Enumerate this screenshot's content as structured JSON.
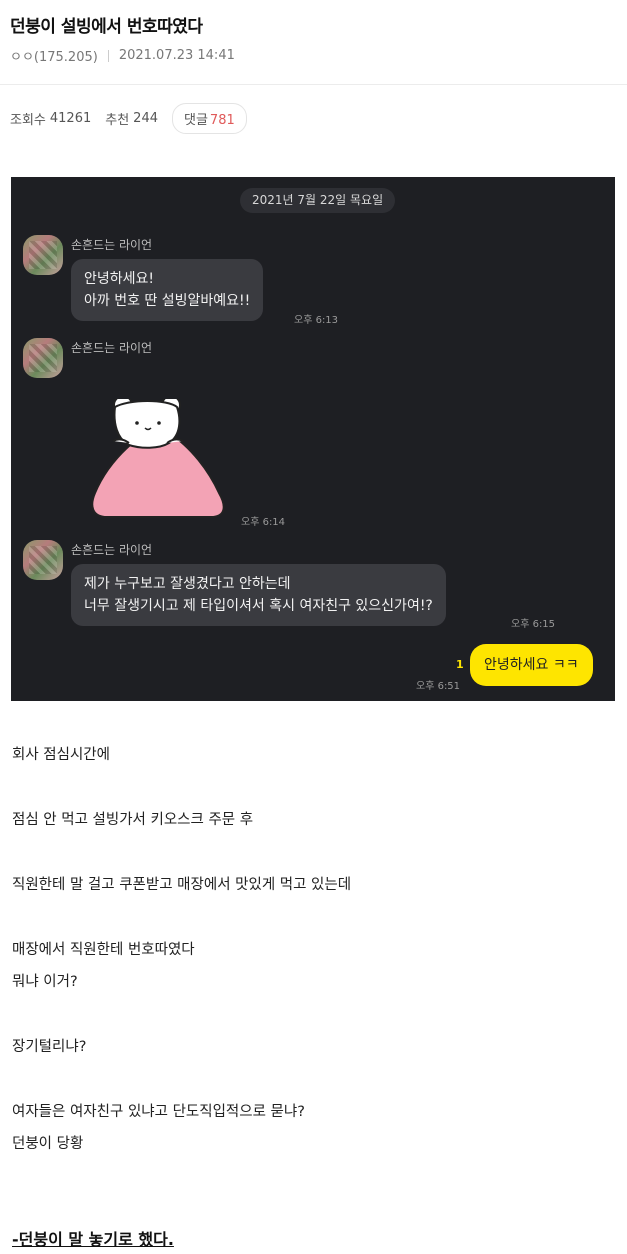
{
  "post": {
    "title": "던붕이 설빙에서 번호따였다",
    "author": "ㅇㅇ(175.205)",
    "datetime": "2021.07.23 14:41"
  },
  "stats": {
    "views_label": "조회수",
    "views": "41261",
    "recommend_label": "추천",
    "recommend": "244",
    "comments_label": "댓글",
    "comments": "781"
  },
  "chat": {
    "date": "2021년 7월 22일 목요일",
    "messages": [
      {
        "sender": "손흔드는 라이언",
        "text": "안녕하세요!\n아까 번호 딴 설빙알바예요!!",
        "time": "오후 6:13"
      },
      {
        "sender": "손흔드는 라이언",
        "text": "",
        "time": "오후 6:14",
        "sticker": "ghost-bear-sticker"
      },
      {
        "sender": "손흔드는 라이언",
        "text": "제가 누구보고 잘생겼다고 안하는데\n너무 잘생기시고 제 타입이셔서 혹시 여자친구 있으신가여!?",
        "time": "오후 6:15"
      }
    ],
    "reply": {
      "text": "안녕하세요 ㅋㅋ",
      "time": "오후 6:51",
      "unread": "1"
    }
  },
  "body": [
    "회사 점심시간에",
    "점심 안 먹고 설빙가서 키오스크 주문 후",
    "직원한테 말 걸고 쿠폰받고 매장에서 맛있게 먹고 있는데",
    "매장에서 직원한테 번호따였다",
    "뭐냐 이거?",
    "장기털리냐?",
    "여자들은 여자친구 있냐고 단도직입적으로 묻냐?",
    "던붕이 당황"
  ],
  "final_line": "-던붕이 말 놓기로 했다.",
  "colors": {
    "chat_bg": "#1e1f23",
    "my_bubble": "#fee500",
    "their_bubble": "#3a3b40",
    "comment_count": "#e05a5a"
  }
}
